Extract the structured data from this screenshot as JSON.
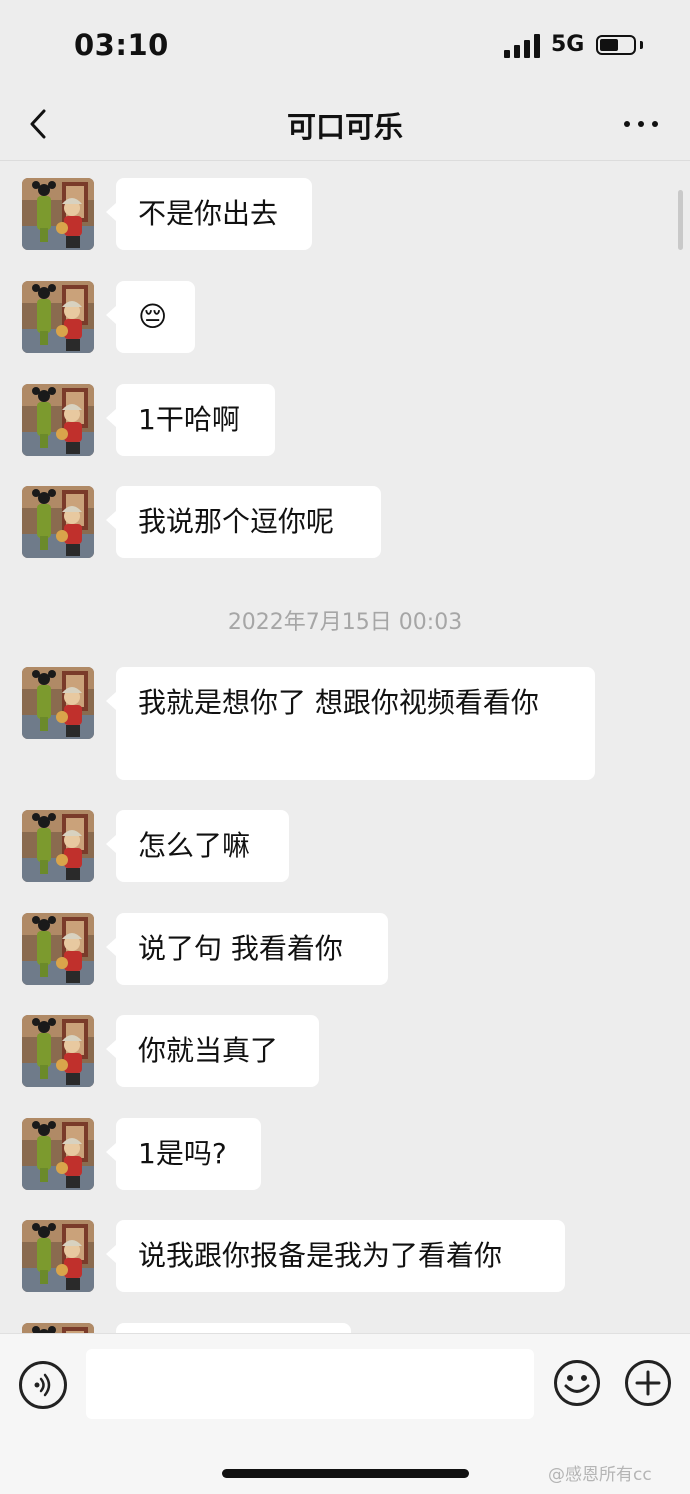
{
  "status_bar": {
    "time": "03:10",
    "network": "5G",
    "battery_level": 0.55
  },
  "header": {
    "title": "可口可乐"
  },
  "messages_before": [
    {
      "text": "不是你出去"
    },
    {
      "text": "😔"
    },
    {
      "text": "1干哈啊"
    },
    {
      "text": "我说那个逗你呢"
    }
  ],
  "timestamp": "2022年7月15日 00:03",
  "messages_after": [
    {
      "text": "我就是想你了 想跟你视频看看你"
    },
    {
      "text": "怎么了嘛"
    },
    {
      "text": "说了句 我看着你"
    },
    {
      "text": "你就当真了"
    },
    {
      "text": "1是吗?"
    },
    {
      "text": "说我跟你报备是我为了看着你"
    }
  ],
  "input": {
    "value": ""
  },
  "watermark": "@感恩所有cc",
  "icons": {
    "back": "chevron-left-icon",
    "more": "more-dots-icon",
    "voice": "voice-icon",
    "emoji": "emoji-icon",
    "plus": "plus-icon"
  },
  "colors": {
    "background": "#ededed",
    "bubble": "#ffffff",
    "timestamp": "#a6a6a6"
  }
}
